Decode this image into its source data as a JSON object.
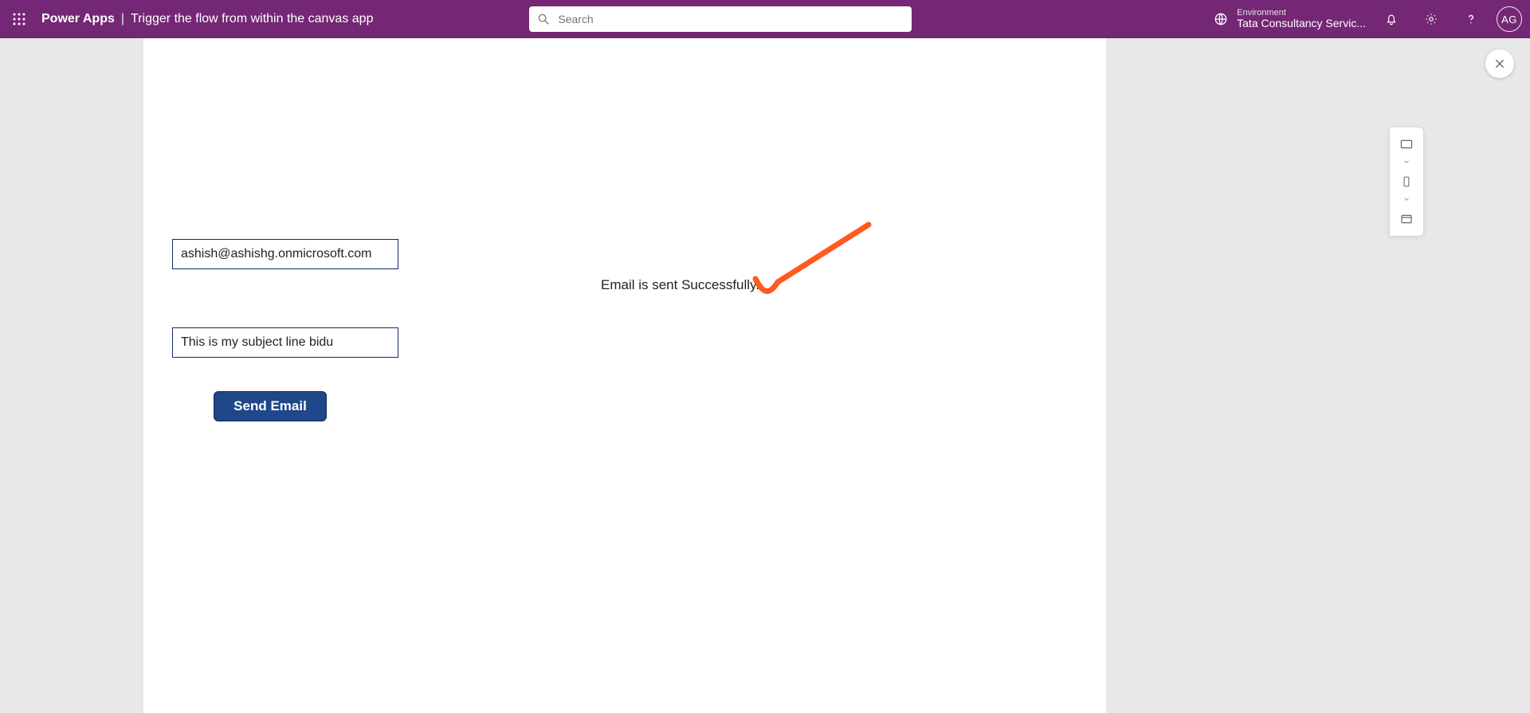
{
  "header": {
    "product": "Power Apps",
    "separator": "|",
    "app_title": "Trigger the flow from within the canvas app",
    "search_placeholder": "Search",
    "environment_label": "Environment",
    "environment_name": "Tata Consultancy Servic...",
    "avatar_initials": "AG"
  },
  "app": {
    "email_value": "ashish@ashishg.onmicrosoft.com",
    "subject_value": "This is my subject line bidu",
    "send_button_label": "Send Email",
    "status_message": "Email is sent Successfully."
  },
  "colors": {
    "brand": "#742774",
    "input_border": "#102a6a",
    "button_bg": "#20478a",
    "annotation": "#ff5a1f"
  }
}
